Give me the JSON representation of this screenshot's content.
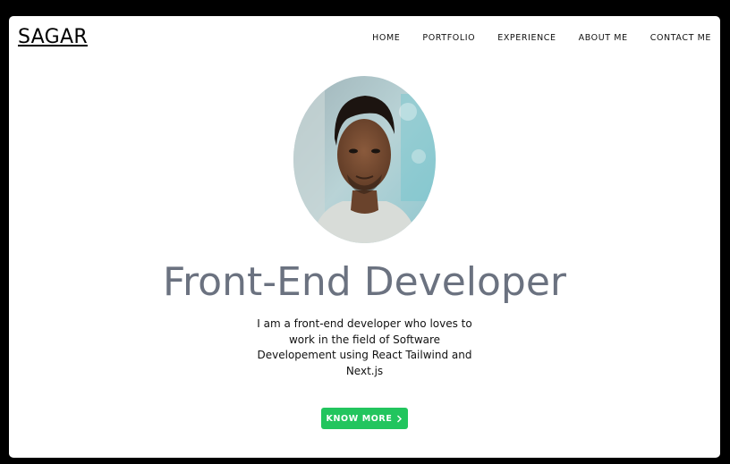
{
  "header": {
    "logo": "SAGAR",
    "nav": [
      "HOME",
      "PORTFOLIO",
      "EXPERIENCE",
      "ABOUT ME",
      "CONTACT ME"
    ]
  },
  "hero": {
    "headline": "Front-End Developer",
    "description": "I am a front-end developer who loves to work in the field of Software Developement using React Tailwind and Next.js",
    "cta_label": "KNOW MORE",
    "cta_icon": "chevron-right-icon"
  },
  "colors": {
    "page_background": "#000000",
    "card_background": "#ffffff",
    "headline": "#6b7280",
    "cta_background": "#22c55e",
    "cta_text": "#ffffff"
  }
}
